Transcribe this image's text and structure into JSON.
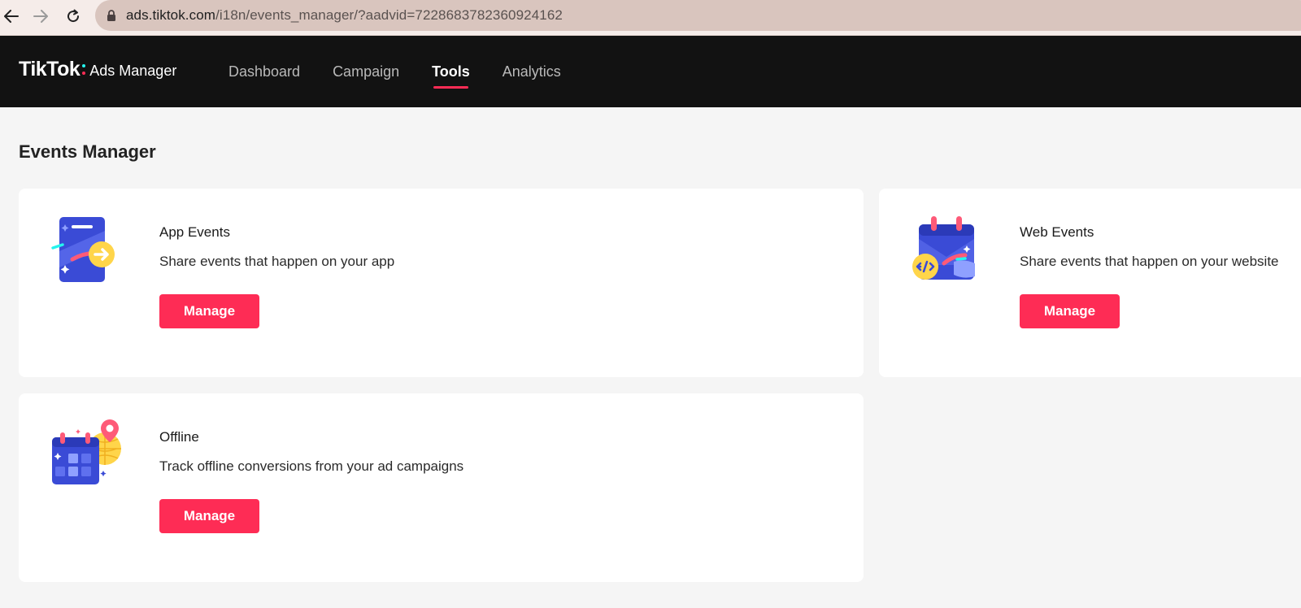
{
  "browser": {
    "url_host": "ads.tiktok.com",
    "url_path": "/i18n/events_manager/?aadvid=7228683782360924162"
  },
  "header": {
    "logo_brand": "TikTok",
    "logo_product": "Ads Manager",
    "nav": [
      {
        "label": "Dashboard",
        "active": false
      },
      {
        "label": "Campaign",
        "active": false
      },
      {
        "label": "Tools",
        "active": true
      },
      {
        "label": "Analytics",
        "active": false
      }
    ]
  },
  "page": {
    "title": "Events Manager"
  },
  "cards": [
    {
      "title": "App Events",
      "description": "Share events that happen on your app",
      "button": "Manage",
      "icon": "app-events-icon"
    },
    {
      "title": "Web Events",
      "description": "Share events that happen on your website",
      "button": "Manage",
      "icon": "web-events-icon"
    },
    {
      "title": "Offline",
      "description": "Track offline conversions from your ad campaigns",
      "button": "Manage",
      "icon": "offline-events-icon"
    }
  ],
  "colors": {
    "accent": "#fe2c55",
    "header_bg": "#121212",
    "page_bg": "#f5f5f5",
    "icon_blue": "#3b4fd8",
    "icon_yellow": "#ffd54a",
    "icon_cyan": "#25f4ee"
  }
}
